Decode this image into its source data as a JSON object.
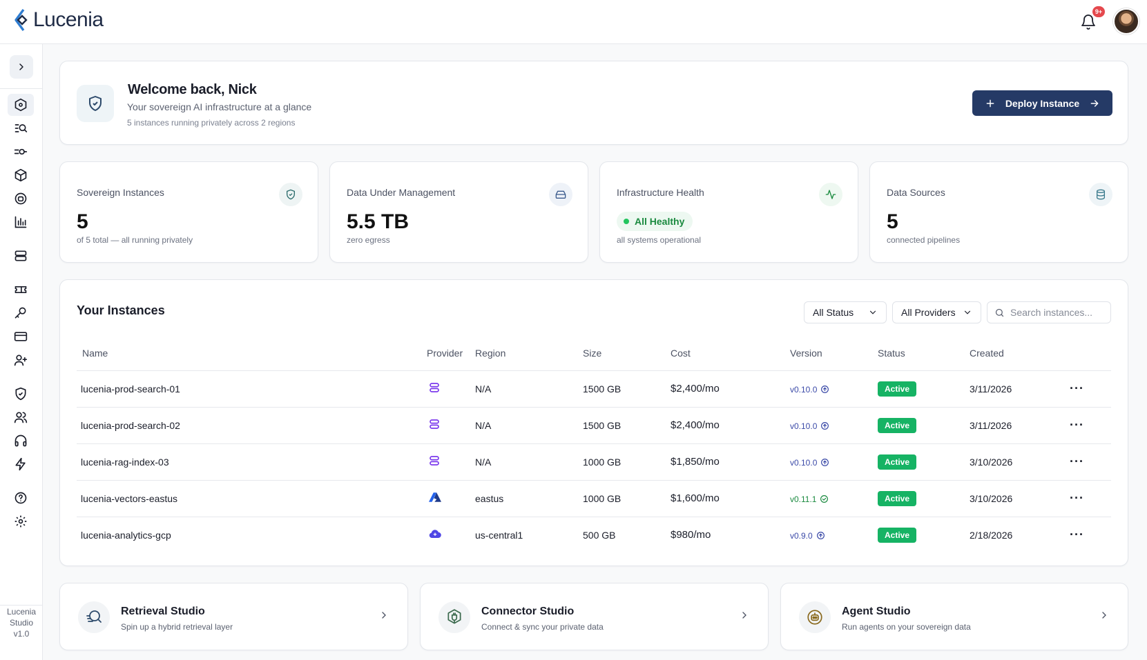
{
  "app": {
    "name": "Lucenia"
  },
  "header": {
    "notification_count": "9+"
  },
  "sidebar": {
    "footer_lines": [
      "Lucenia",
      "Studio",
      "v1.0"
    ]
  },
  "welcome": {
    "title": "Welcome back, Nick",
    "subtitle": "Your sovereign AI infrastructure at a glance",
    "note": "5 instances running privately across 2 regions",
    "deploy_label": "Deploy Instance"
  },
  "stats": [
    {
      "label": "Sovereign Instances",
      "value": "5",
      "sub": "of 5 total — all running privately",
      "icon": "shield-check-icon"
    },
    {
      "label": "Data Under Management",
      "value": "5.5 TB",
      "sub": "zero egress",
      "icon": "hard-drive-icon"
    },
    {
      "label": "Infrastructure Health",
      "value": "All Healthy",
      "sub": "all systems operational",
      "icon": "activity-icon"
    },
    {
      "label": "Data Sources",
      "value": "5",
      "sub": "connected pipelines",
      "icon": "database-icon"
    }
  ],
  "instances": {
    "title": "Your Instances",
    "status_filter": "All Status",
    "provider_filter": "All Providers",
    "search_placeholder": "Search instances...",
    "columns": [
      "Name",
      "Provider",
      "Region",
      "Size",
      "Cost",
      "Version",
      "Status",
      "Created"
    ],
    "rows": [
      {
        "name": "lucenia-prod-search-01",
        "provider": "lucenia-icon",
        "region": "N/A",
        "size": "1500 GB",
        "cost": "$2,400/mo",
        "version": "v0.10.0",
        "version_state": "upgrade",
        "status": "Active",
        "created": "3/11/2026"
      },
      {
        "name": "lucenia-prod-search-02",
        "provider": "lucenia-icon",
        "region": "N/A",
        "size": "1500 GB",
        "cost": "$2,400/mo",
        "version": "v0.10.0",
        "version_state": "upgrade",
        "status": "Active",
        "created": "3/11/2026"
      },
      {
        "name": "lucenia-rag-index-03",
        "provider": "lucenia-icon",
        "region": "N/A",
        "size": "1000 GB",
        "cost": "$1,850/mo",
        "version": "v0.10.0",
        "version_state": "upgrade",
        "status": "Active",
        "created": "3/10/2026"
      },
      {
        "name": "lucenia-vectors-eastus",
        "provider": "azure-icon",
        "region": "eastus",
        "size": "1000 GB",
        "cost": "$1,600/mo",
        "version": "v0.11.1",
        "version_state": "current",
        "status": "Active",
        "created": "3/10/2026"
      },
      {
        "name": "lucenia-analytics-gcp",
        "provider": "gcp-icon",
        "region": "us-central1",
        "size": "500 GB",
        "cost": "$980/mo",
        "version": "v0.9.0",
        "version_state": "upgrade",
        "status": "Active",
        "created": "2/18/2026"
      }
    ]
  },
  "studios": [
    {
      "title": "Retrieval Studio",
      "sub": "Spin up a hybrid retrieval layer",
      "icon": "retrieval-icon"
    },
    {
      "title": "Connector Studio",
      "sub": "Connect & sync your private data",
      "icon": "connector-icon"
    },
    {
      "title": "Agent Studio",
      "sub": "Run agents on your sovereign data",
      "icon": "agent-icon"
    }
  ],
  "colors": {
    "primary": "#253a66",
    "success": "#16b364",
    "accent": "#2f7dd1",
    "version": "#3b4aa8"
  }
}
